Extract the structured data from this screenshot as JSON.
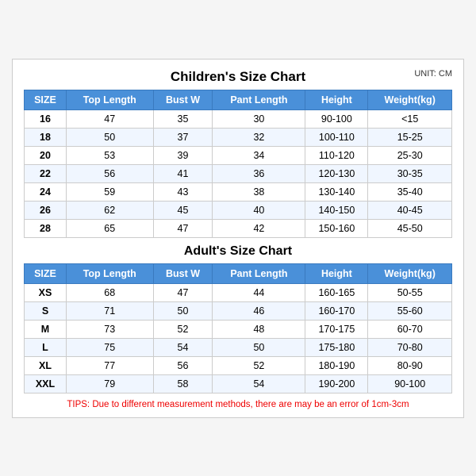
{
  "chart": {
    "main_title": "Children's Size Chart",
    "unit_label": "UNIT: CM",
    "children_headers": [
      "SIZE",
      "Top Length",
      "Bust W",
      "Pant Length",
      "Height",
      "Weight(kg)"
    ],
    "children_rows": [
      [
        "16",
        "47",
        "35",
        "30",
        "90-100",
        "<15"
      ],
      [
        "18",
        "50",
        "37",
        "32",
        "100-110",
        "15-25"
      ],
      [
        "20",
        "53",
        "39",
        "34",
        "110-120",
        "25-30"
      ],
      [
        "22",
        "56",
        "41",
        "36",
        "120-130",
        "30-35"
      ],
      [
        "24",
        "59",
        "43",
        "38",
        "130-140",
        "35-40"
      ],
      [
        "26",
        "62",
        "45",
        "40",
        "140-150",
        "40-45"
      ],
      [
        "28",
        "65",
        "47",
        "42",
        "150-160",
        "45-50"
      ]
    ],
    "adult_title": "Adult's Size Chart",
    "adult_headers": [
      "SIZE",
      "Top Length",
      "Bust W",
      "Pant Length",
      "Height",
      "Weight(kg)"
    ],
    "adult_rows": [
      [
        "XS",
        "68",
        "47",
        "44",
        "160-165",
        "50-55"
      ],
      [
        "S",
        "71",
        "50",
        "46",
        "160-170",
        "55-60"
      ],
      [
        "M",
        "73",
        "52",
        "48",
        "170-175",
        "60-70"
      ],
      [
        "L",
        "75",
        "54",
        "50",
        "175-180",
        "70-80"
      ],
      [
        "XL",
        "77",
        "56",
        "52",
        "180-190",
        "80-90"
      ],
      [
        "XXL",
        "79",
        "58",
        "54",
        "190-200",
        "90-100"
      ]
    ],
    "tips": "TIPS: Due to different measurement methods, there are may be an error of 1cm-3cm"
  }
}
